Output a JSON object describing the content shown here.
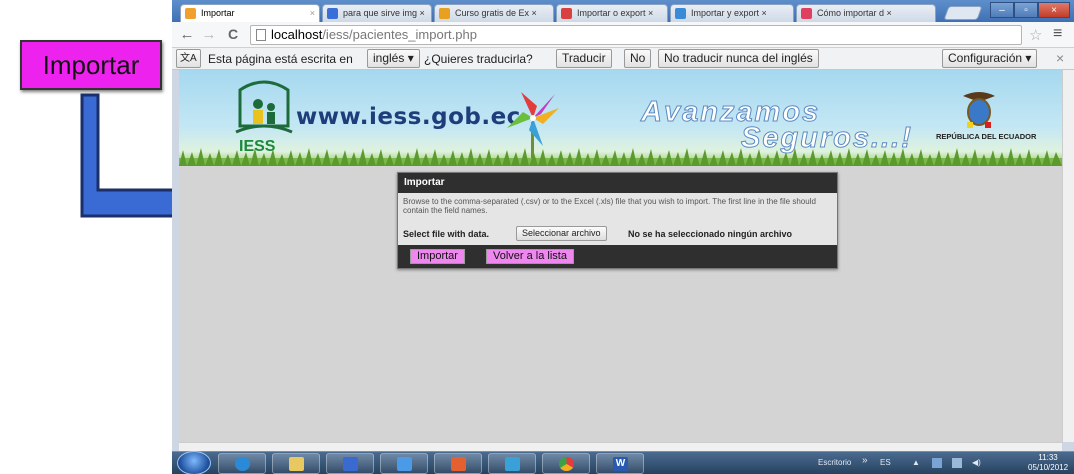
{
  "callout": {
    "label": "Importar"
  },
  "browser": {
    "tabs": [
      {
        "title": "Importar",
        "fav": "#f0a030"
      },
      {
        "title": "para que sirve img ×",
        "fav": "#3a6fd8"
      },
      {
        "title": "Curso gratis de Ex ×",
        "fav": "#e8a020"
      },
      {
        "title": "Importar o export ×",
        "fav": "#d94040"
      },
      {
        "title": "Importar y export ×",
        "fav": "#3a8ad8"
      },
      {
        "title": "Cómo importar d ×",
        "fav": "#e04060"
      }
    ],
    "url_host": "localhost",
    "url_path": "/iess/pacientes_import.php",
    "back_icon": "←",
    "forward_icon": "→",
    "reload_icon": "C",
    "star_icon": "☆",
    "menu_icon": "≡"
  },
  "translate_bar": {
    "icon_text": "文A",
    "prefix": "Esta página está escrita en",
    "language": "inglés ▾",
    "question": "¿Quieres traducirla?",
    "translate_btn": "Traducir",
    "no_btn": "No",
    "never_btn": "No traducir nunca del inglés",
    "config_btn": "Configuración ▾",
    "close": "×"
  },
  "banner": {
    "site": "www.iess.gob.ec",
    "logo_word": "IESS",
    "slogan_line1": "Avanzamos",
    "slogan_line2": "Seguros...!",
    "republic": "REPÚBLICA DEL ECUADOR"
  },
  "dialog": {
    "title": "Importar",
    "description": "Browse to the comma-separated (.csv) or to the Excel (.xls) file that you wish to import. The first line in the file should contain the field names.",
    "file_label": "Select file with data.",
    "file_button": "Seleccionar archivo",
    "file_status": "No se ha seleccionado ningún archivo",
    "import_button": "Importar",
    "back_button": "Volver a la lista"
  },
  "taskbar": {
    "desktop": "Escritorio",
    "chevrons": "»",
    "lang": "ES",
    "time": "11:33",
    "date": "05/10/2012"
  },
  "colors": {
    "accent": "#ee22ee",
    "dialog_head": "#2f2f2f",
    "button_pink": "#ee88ee"
  }
}
